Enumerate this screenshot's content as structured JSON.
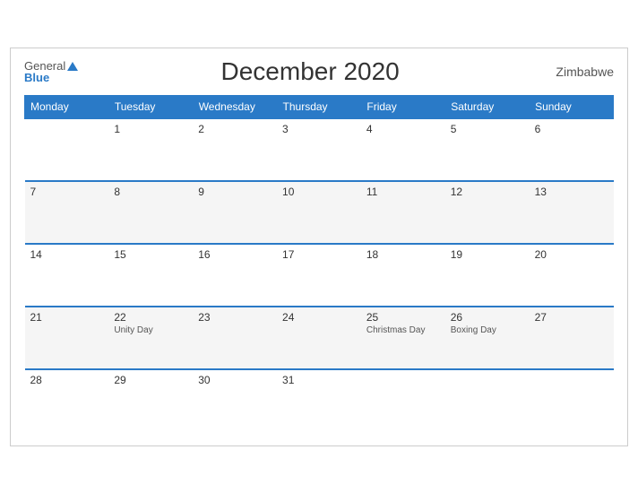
{
  "header": {
    "logo_general": "General",
    "logo_blue": "Blue",
    "title": "December 2020",
    "country": "Zimbabwe"
  },
  "days_of_week": [
    "Monday",
    "Tuesday",
    "Wednesday",
    "Thursday",
    "Friday",
    "Saturday",
    "Sunday"
  ],
  "weeks": [
    [
      {
        "date": "",
        "holiday": ""
      },
      {
        "date": "1",
        "holiday": ""
      },
      {
        "date": "2",
        "holiday": ""
      },
      {
        "date": "3",
        "holiday": ""
      },
      {
        "date": "4",
        "holiday": ""
      },
      {
        "date": "5",
        "holiday": ""
      },
      {
        "date": "6",
        "holiday": ""
      }
    ],
    [
      {
        "date": "7",
        "holiday": ""
      },
      {
        "date": "8",
        "holiday": ""
      },
      {
        "date": "9",
        "holiday": ""
      },
      {
        "date": "10",
        "holiday": ""
      },
      {
        "date": "11",
        "holiday": ""
      },
      {
        "date": "12",
        "holiday": ""
      },
      {
        "date": "13",
        "holiday": ""
      }
    ],
    [
      {
        "date": "14",
        "holiday": ""
      },
      {
        "date": "15",
        "holiday": ""
      },
      {
        "date": "16",
        "holiday": ""
      },
      {
        "date": "17",
        "holiday": ""
      },
      {
        "date": "18",
        "holiday": ""
      },
      {
        "date": "19",
        "holiday": ""
      },
      {
        "date": "20",
        "holiday": ""
      }
    ],
    [
      {
        "date": "21",
        "holiday": ""
      },
      {
        "date": "22",
        "holiday": "Unity Day"
      },
      {
        "date": "23",
        "holiday": ""
      },
      {
        "date": "24",
        "holiday": ""
      },
      {
        "date": "25",
        "holiday": "Christmas Day"
      },
      {
        "date": "26",
        "holiday": "Boxing Day"
      },
      {
        "date": "27",
        "holiday": ""
      }
    ],
    [
      {
        "date": "28",
        "holiday": ""
      },
      {
        "date": "29",
        "holiday": ""
      },
      {
        "date": "30",
        "holiday": ""
      },
      {
        "date": "31",
        "holiday": ""
      },
      {
        "date": "",
        "holiday": ""
      },
      {
        "date": "",
        "holiday": ""
      },
      {
        "date": "",
        "holiday": ""
      }
    ]
  ]
}
